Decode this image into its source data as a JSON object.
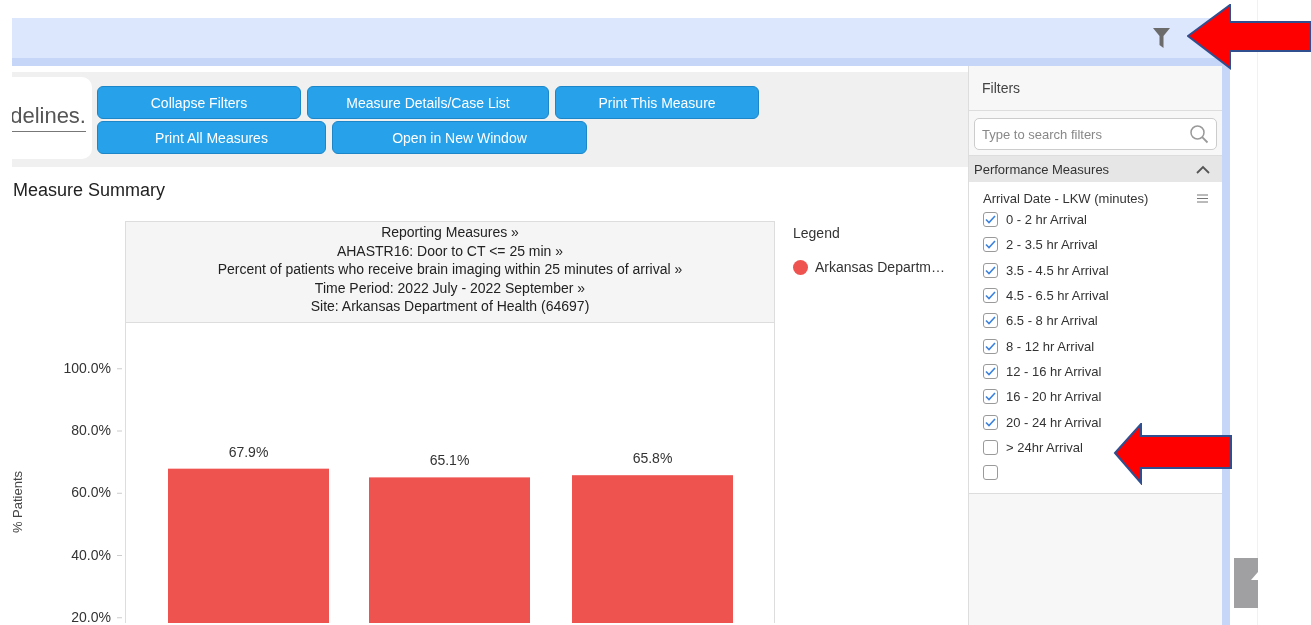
{
  "toolbar": {
    "logo_text": "delines.",
    "buttons": [
      "Collapse Filters",
      "Measure Details/Case List",
      "Print This Measure",
      "Print All Measures",
      "Open in New Window"
    ]
  },
  "heading": "Measure Summary",
  "chart": {
    "header_lines": [
      "Reporting Measures »",
      "AHASTR16: Door to CT <= 25 min »",
      "Percent of patients who receive brain imaging within 25 minutes of arrival »",
      "Time Period: 2022 July - 2022 September »",
      "Site: Arkansas Department of Health (64697)"
    ],
    "chart_data": {
      "type": "bar",
      "ylabel": "% Patients",
      "ylim": [
        0,
        114.7
      ],
      "yticks": [
        {
          "value": 20,
          "label": "20.0%"
        },
        {
          "value": 40,
          "label": "40.0%"
        },
        {
          "value": 60,
          "label": "60.0%"
        },
        {
          "value": 80,
          "label": "80.0%"
        },
        {
          "value": 100,
          "label": "100.0%"
        }
      ],
      "series": [
        {
          "name": "Arkansas Departm…",
          "color": "#ef5350",
          "values": [
            67.9,
            65.1,
            65.8
          ]
        }
      ],
      "value_labels": [
        "67.9%",
        "65.1%",
        "65.8%"
      ]
    },
    "legend": {
      "title": "Legend"
    }
  },
  "filters": {
    "title": "Filters",
    "search": {
      "placeholder": "Type to search filters"
    },
    "section": {
      "title": "Performance Measures",
      "expanded": true,
      "group": {
        "title": "Arrival Date - LKW (minutes)",
        "options": [
          {
            "label": "0 - 2 hr Arrival",
            "checked": true
          },
          {
            "label": "2 - 3.5 hr Arrival",
            "checked": true
          },
          {
            "label": "3.5 - 4.5 hr Arrival",
            "checked": true
          },
          {
            "label": "4.5 - 6.5 hr Arrival",
            "checked": true
          },
          {
            "label": "6.5 - 8 hr Arrival",
            "checked": true
          },
          {
            "label": "8 - 12 hr Arrival",
            "checked": true
          },
          {
            "label": "12 - 16 hr Arrival",
            "checked": true
          },
          {
            "label": "16 - 20 hr Arrival",
            "checked": true
          },
          {
            "label": "20 - 24 hr Arrival",
            "checked": true
          },
          {
            "label": "> 24hr Arrival",
            "checked": false
          },
          {
            "checked": false
          }
        ]
      }
    }
  }
}
